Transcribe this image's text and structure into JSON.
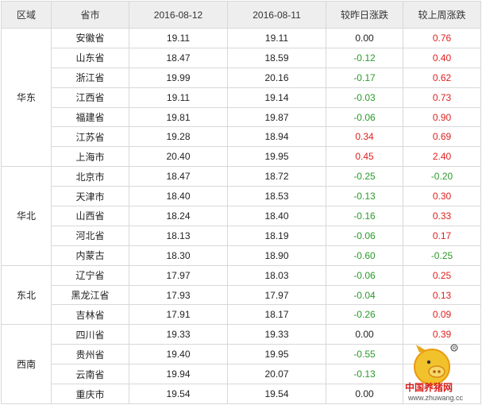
{
  "headers": [
    "区域",
    "省市",
    "2016-08-12",
    "2016-08-11",
    "较昨日涨跌",
    "较上周涨跌"
  ],
  "groups": [
    {
      "region": "华东",
      "rows": [
        {
          "province": "安徽省",
          "d1": "19.11",
          "d2": "19.11",
          "day": "0.00",
          "week": "0.76"
        },
        {
          "province": "山东省",
          "d1": "18.47",
          "d2": "18.59",
          "day": "-0.12",
          "week": "0.40"
        },
        {
          "province": "浙江省",
          "d1": "19.99",
          "d2": "20.16",
          "day": "-0.17",
          "week": "0.62"
        },
        {
          "province": "江西省",
          "d1": "19.11",
          "d2": "19.14",
          "day": "-0.03",
          "week": "0.73"
        },
        {
          "province": "福建省",
          "d1": "19.81",
          "d2": "19.87",
          "day": "-0.06",
          "week": "0.90"
        },
        {
          "province": "江苏省",
          "d1": "19.28",
          "d2": "18.94",
          "day": "0.34",
          "week": "0.69"
        },
        {
          "province": "上海市",
          "d1": "20.40",
          "d2": "19.95",
          "day": "0.45",
          "week": "2.40"
        }
      ]
    },
    {
      "region": "华北",
      "rows": [
        {
          "province": "北京市",
          "d1": "18.47",
          "d2": "18.72",
          "day": "-0.25",
          "week": "-0.20"
        },
        {
          "province": "天津市",
          "d1": "18.40",
          "d2": "18.53",
          "day": "-0.13",
          "week": "0.30"
        },
        {
          "province": "山西省",
          "d1": "18.24",
          "d2": "18.40",
          "day": "-0.16",
          "week": "0.33"
        },
        {
          "province": "河北省",
          "d1": "18.13",
          "d2": "18.19",
          "day": "-0.06",
          "week": "0.17"
        },
        {
          "province": "内蒙古",
          "d1": "18.30",
          "d2": "18.90",
          "day": "-0.60",
          "week": "-0.25"
        }
      ]
    },
    {
      "region": "东北",
      "rows": [
        {
          "province": "辽宁省",
          "d1": "17.97",
          "d2": "18.03",
          "day": "-0.06",
          "week": "0.25"
        },
        {
          "province": "黑龙江省",
          "d1": "17.93",
          "d2": "17.97",
          "day": "-0.04",
          "week": "0.13"
        },
        {
          "province": "吉林省",
          "d1": "17.91",
          "d2": "18.17",
          "day": "-0.26",
          "week": "0.09"
        }
      ]
    },
    {
      "region": "西南",
      "rows": [
        {
          "province": "四川省",
          "d1": "19.33",
          "d2": "19.33",
          "day": "0.00",
          "week": "0.39"
        },
        {
          "province": "贵州省",
          "d1": "19.40",
          "d2": "19.95",
          "day": "-0.55",
          "week": ""
        },
        {
          "province": "云南省",
          "d1": "19.94",
          "d2": "20.07",
          "day": "-0.13",
          "week": ""
        },
        {
          "province": "重庆市",
          "d1": "19.54",
          "d2": "19.54",
          "day": "0.00",
          "week": ""
        }
      ]
    }
  ],
  "watermark": {
    "name": "中国养猪网",
    "url": "www.zhuwang.cc"
  },
  "colors": {
    "up": "#e02020",
    "down": "#2a9a2a",
    "header_bg": "#eeeeee",
    "border": "#d8d8d8"
  }
}
